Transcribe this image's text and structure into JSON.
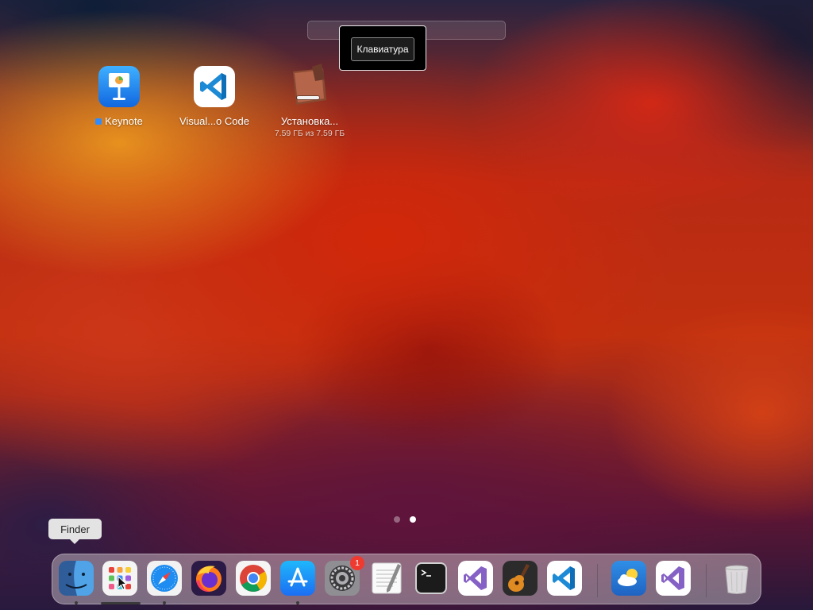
{
  "launchpad": {
    "tooltip": "Клавиатура",
    "apps": [
      {
        "label": "Keynote",
        "sublabel": ""
      },
      {
        "label": "Visual...o Code",
        "sublabel": ""
      },
      {
        "label": "Установка...",
        "sublabel": "7.59 ГБ из 7.59 ГБ",
        "progress": 1.0
      }
    ],
    "page_count": 2,
    "current_page": 2
  },
  "dock": {
    "hover_tooltip": "Finder",
    "items": [
      "Finder",
      "Launchpad",
      "Safari",
      "Firefox",
      "Google Chrome",
      "App Store",
      "System Settings",
      "TextEdit",
      "Terminal",
      "Visual Studio",
      "GarageBand",
      "Visual Studio Code",
      "Weather",
      "Visual Studio",
      "Trash"
    ],
    "system_settings_badge": "1"
  }
}
